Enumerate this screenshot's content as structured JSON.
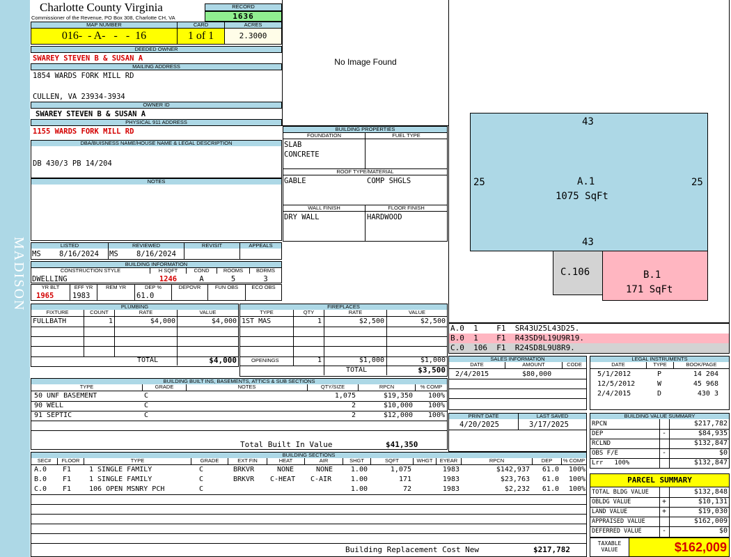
{
  "sidebar": {
    "label": "MADISON"
  },
  "header": {
    "county": "Charlotte County Virginia",
    "commissioner": "Commissioner of the Revenue, PO Box 308, Charlotte CH, VA",
    "record_label": "RECORD",
    "record": "1636",
    "map_label": "MAP NUMBER",
    "map_number": "016-  - A-   -   -  16",
    "card_label": "CARD",
    "card": "1 of 1",
    "acres_label": "ACRES",
    "acres": "2.3000"
  },
  "owner": {
    "deeded_label": "DEEDED OWNER",
    "deeded_owner": "SWAREY STEVEN B & SUSAN A",
    "mailing_label": "MAILING ADDRESS",
    "mailing_line1": "1854 WARDS FORK MILL RD",
    "mailing_line2": "CULLEN, VA 23934-3934",
    "owner_id_label": "OWNER ID",
    "owner_id": "SWAREY STEVEN B & SUSAN A",
    "physical_label": "PHYSICAL 911 ADDRESS",
    "physical": "1155 WARDS FORK MILL RD",
    "dba_label": "DBA/BUISNESS NAME/HOUSE NAME & LEGAL DESCRIPTION",
    "dba": "DB 430/3 PB 14/204",
    "notes_label": "NOTES"
  },
  "image": {
    "text": "No Image Found"
  },
  "props": {
    "title": "BUILDING PROPERTIES",
    "foundation_label": "FOUNDATION",
    "fuel_label": "FUEL TYPE",
    "foundation1": "SLAB",
    "foundation2": "CONCRETE",
    "roof_label": "ROOF TYPE/MATERIAL",
    "roof_type": "GABLE",
    "roof_material": "COMP SHGLS",
    "wall_label": "WALL FINISH",
    "floor_label": "FLOOR FINISH",
    "wall": "DRY WALL",
    "floor": "HARDWOOD"
  },
  "status": {
    "listed_label": "LISTED",
    "reviewed_label": "REVIEWED",
    "revisit_label": "REVISIT",
    "appeals_label": "APPEALS",
    "listed_by": "MS",
    "listed": "8/16/2024",
    "reviewed_by": "MS",
    "reviewed": "8/16/2024"
  },
  "bldg_info": {
    "title": "BUILDING INFORMATION",
    "style_label": "CONSTRUCTION STYLE",
    "hsqft_label": "H SQFT",
    "cond_label": "COND",
    "rooms_label": "ROOMS",
    "bdrms_label": "BDRMS",
    "style": "DWELLING",
    "hsqft": "1246",
    "cond": "A",
    "rooms": "5",
    "bdrms": "3",
    "yrblt_label": "YR BLT",
    "effyr_label": "EFF YR",
    "remyr_label": "REM YR",
    "dep_label": "DEP %",
    "depovr_label": "DEPOVR",
    "funobs_label": "FUN OBS",
    "ecoobs_label": "ECO OBS",
    "yrblt": "1965",
    "effyr": "1983",
    "dep": "61.0"
  },
  "plumbing": {
    "title": "PLUMBING",
    "headers": [
      "FIXTURE",
      "COUNT",
      "RATE",
      "VALUE"
    ],
    "rows": [
      [
        "FULLBATH",
        "1",
        "$4,000",
        "$4,000"
      ]
    ],
    "total_label": "TOTAL",
    "total": "$4,000"
  },
  "fireplaces": {
    "title": "FIREPLACES",
    "headers": [
      "TYPE",
      "QTY",
      "RATE",
      "VALUE"
    ],
    "rows": [
      [
        "1ST MAS",
        "1",
        "$2,500",
        "$2,500"
      ]
    ],
    "openings_label": "OPENINGS",
    "openings": [
      "1",
      "$1,000",
      "$1,000"
    ],
    "total_label": "TOTAL",
    "total": "$3,500"
  },
  "builtins": {
    "title": "BUILDING BUILT INS, BASEMENTS, ATTICS & SUB SECTIONS",
    "headers": [
      "TYPE",
      "GRADE",
      "NOTES",
      "QTY/SIZE",
      "RPCN",
      "% COMP"
    ],
    "rows": [
      [
        "50 UNF BASEMENT",
        "C",
        "",
        "1,075",
        "$19,350",
        "100%"
      ],
      [
        "90 WELL",
        "C",
        "",
        "2",
        "$10,000",
        "100%"
      ],
      [
        "91 SEPTIC",
        "C",
        "",
        "2",
        "$12,000",
        "100%"
      ]
    ],
    "total_label": "Total Built In Value",
    "total": "$41,350"
  },
  "sections": {
    "title": "BUILDING SECTIONS",
    "headers": [
      "SEC#",
      "FLOOR",
      "TYPE",
      "GRADE",
      "EXT FIN",
      "HEAT",
      "AIR",
      "SHGT",
      "SQFT",
      "WHGT",
      "EYEAR",
      "RPCN",
      "DEP",
      "% COMP"
    ],
    "rows": [
      [
        "A.0",
        "F1",
        "1 SINGLE FAMILY",
        "C",
        "BRKVR",
        "NONE",
        "NONE",
        "1.00",
        "1,075",
        "",
        "1983",
        "$142,937",
        "61.0",
        "100%"
      ],
      [
        "B.0",
        "F1",
        "1 SINGLE FAMILY",
        "C",
        "BRKVR",
        "C-HEAT",
        "C-AIR",
        "1.00",
        "171",
        "",
        "1983",
        "$23,763",
        "61.0",
        "100%"
      ],
      [
        "C.0",
        "F1",
        "106 OPEN MSNRY PCH",
        "C",
        "",
        "",
        "",
        "1.00",
        "72",
        "",
        "1983",
        "$2,232",
        "61.0",
        "100%"
      ]
    ],
    "total_label": "Building Replacement Cost New",
    "total": "$217,782"
  },
  "sketch": {
    "a_top": "43",
    "a_left": "25",
    "a_right": "25",
    "a_bottom": "43",
    "a_name": "A.1",
    "a_area": "1075 SqFt",
    "b_name": "B.1",
    "b_area": "171 SqFt",
    "c_name": "C.106"
  },
  "sketch_codes": [
    {
      "text": "A.0  1    F1  SR43U25L43D25.",
      "bg": "#ffffff"
    },
    {
      "text": "B.0  1    F1  R43SD9L19U9R19.",
      "bg": "#ffb6c1"
    },
    {
      "text": "C.0  106  F1  R24SD8L9U8R9.",
      "bg": "#d3d3d3"
    }
  ],
  "sales": {
    "title": "SALES INFORMATION",
    "headers": [
      "DATE",
      "AMOUNT",
      "CODE"
    ],
    "rows": [
      [
        "2/4/2015",
        "$80,000",
        ""
      ]
    ]
  },
  "legal": {
    "title": "LEGAL INSTRUMENTS",
    "headers": [
      "DATE",
      "TYPE",
      "BOOK/PAGE"
    ],
    "rows": [
      [
        "5/1/2012",
        "P",
        "14 204"
      ],
      [
        "12/5/2012",
        "W",
        "45 968"
      ],
      [
        "2/4/2015",
        "D",
        "430 3"
      ]
    ]
  },
  "dates": {
    "print_label": "PRINT DATE",
    "saved_label": "LAST SAVED",
    "print": "4/20/2025",
    "saved": "3/17/2025"
  },
  "bvs": {
    "title": "BUILDING VALUE SUMMARY",
    "rows": [
      [
        "RPCN",
        "",
        "$217,782"
      ],
      [
        "DEP",
        "-",
        "$84,935"
      ],
      [
        "RCLND",
        "",
        "$132,847"
      ],
      [
        "OBS F/E",
        "-",
        "$0"
      ],
      [
        "Lrr   100%",
        "",
        "$132,847"
      ]
    ]
  },
  "parcel": {
    "title": "PARCEL SUMMARY",
    "rows": [
      [
        "TOTAL BLDG VALUE",
        "",
        "$132,848"
      ],
      [
        "OBLDG VALUE",
        "+",
        "$10,131"
      ],
      [
        "LAND VALUE",
        "+",
        "$19,030"
      ],
      [
        "APPRAISED VALUE",
        "",
        "$162,009"
      ],
      [
        "DEFERRED VALUE",
        "-",
        "$0"
      ]
    ],
    "taxable_label": "TAXABLE VALUE",
    "taxable": "$162,009"
  },
  "colors": {
    "header_bg": "#add8e6",
    "sidebar": "#add8e6",
    "record_bg": "#90ee90",
    "map_bg": "#ffff00",
    "acres_bg": "#fffde8",
    "sketch_a": "#add8e6",
    "sketch_b": "#ffb6c1",
    "sketch_c": "#d3d3d3",
    "red": "#d40000"
  }
}
